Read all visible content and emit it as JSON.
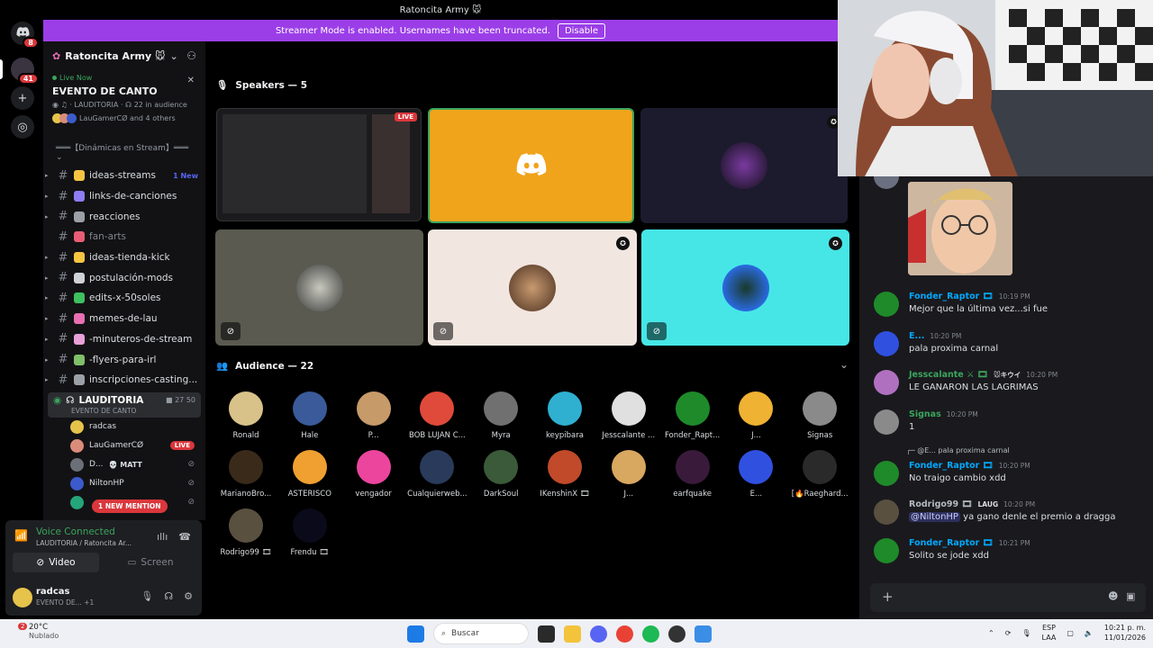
{
  "window": {
    "title": "Ratoncita Army 🐭"
  },
  "banner": {
    "text": "Streamer Mode is enabled. Usernames have been truncated.",
    "button": "Disable"
  },
  "rail": {
    "dm_badge": "8",
    "server_badge": "41"
  },
  "server": {
    "name": "Ratoncita Army 🐭"
  },
  "live_event": {
    "status": "Live Now",
    "title": "EVENTO DE CANTO",
    "channel": "LAUDITORIA",
    "audience": "22 in audience",
    "people": "LauGamerCØ and 4 others"
  },
  "category": "═══【Dinámicas en Stream】═══",
  "channels": [
    {
      "name": "ideas-streams",
      "badge": "1 New",
      "color": "#f5c542"
    },
    {
      "name": "links-de-canciones",
      "badge": "",
      "color": "#8e7cf5"
    },
    {
      "name": "reacciones",
      "badge": "",
      "color": "#9aa0a6"
    },
    {
      "name": "fan-arts",
      "badge": "",
      "color": "#e85d75"
    },
    {
      "name": "ideas-tienda-kick",
      "badge": "",
      "color": "#f5c542"
    },
    {
      "name": "postulación-mods",
      "badge": "",
      "color": "#cfd2d6"
    },
    {
      "name": "edits-x-50soles",
      "badge": "",
      "color": "#3fbf5f"
    },
    {
      "name": "memes-de-lau",
      "badge": "",
      "color": "#e86fb2"
    },
    {
      "name": "-minuteros-de-stream",
      "badge": "",
      "color": "#e8a0d8"
    },
    {
      "name": "-flyers-para-irl",
      "badge": "",
      "color": "#7fbf6a"
    },
    {
      "name": "inscripciones-casting...",
      "badge": "",
      "color": "#9aa0a6"
    }
  ],
  "voice_channel": {
    "name": "LAUDITORIA",
    "event": "EVENTO DE CANTO",
    "counts": "27  50",
    "users": [
      {
        "name": "radcas",
        "tag": "",
        "color": "#e6c34a"
      },
      {
        "name": "LauGamerCØ",
        "tag": "LIVE",
        "color": "#d98c7a"
      },
      {
        "name": "D...",
        "tag": "💀 MATT",
        "color": "#6b6f78"
      },
      {
        "name": "NiltonHP",
        "tag": "",
        "color": "#3b5bcc"
      },
      {
        "name": "",
        "tag": "",
        "color": "#25a57a"
      }
    ],
    "mention": "1 NEW MENTION"
  },
  "voice_panel": {
    "title": "Voice Connected",
    "subtitle": "LAUDITORIA / Ratoncita Ar...",
    "video": "Video",
    "screen": "Screen"
  },
  "user": {
    "name": "radcas",
    "status": "EVENTO DE...",
    "extra": "+1"
  },
  "speakers": {
    "header": "Speakers — 5",
    "live_label": "LIVE"
  },
  "audience": {
    "header": "Audience — 22",
    "members": [
      {
        "name": "Ronald",
        "color": "#d8c28a"
      },
      {
        "name": "Hale",
        "color": "#3a5a9a"
      },
      {
        "name": "P...",
        "color": "#c79a6a"
      },
      {
        "name": "BOB LUJAN C...",
        "color": "#e04a3a"
      },
      {
        "name": "Myra",
        "color": "#707070"
      },
      {
        "name": "keypibara",
        "color": "#2fb0d0"
      },
      {
        "name": "Jesscalante ...",
        "color": "#e0e0e0"
      },
      {
        "name": "Fonder_Rapt...",
        "color": "#1f8a2a"
      },
      {
        "name": "J...",
        "color": "#f0b232"
      },
      {
        "name": "Signas",
        "color": "#8a8a8a"
      },
      {
        "name": "MarianoBro...",
        "color": "#3a2a1a"
      },
      {
        "name": "ASTERISCO",
        "color": "#f0a030"
      },
      {
        "name": "vengador",
        "color": "#eb459e"
      },
      {
        "name": "Cualquierweb...",
        "color": "#2a3a5a"
      },
      {
        "name": "DarkSoul",
        "color": "#3a5a3a"
      },
      {
        "name": "IKenshinX 🎞",
        "color": "#c04a2a"
      },
      {
        "name": "J...",
        "color": "#d8a860"
      },
      {
        "name": "earfquake",
        "color": "#3a1a3a"
      },
      {
        "name": "E...",
        "color": "#3050e0"
      },
      {
        "name": "[🔥Raeghard...",
        "color": "#2a2a2a"
      },
      {
        "name": "Rodrigo99 🎞",
        "color": "#5a5040"
      },
      {
        "name": "Frendu 🎞",
        "color": "#0a0a1a"
      }
    ]
  },
  "chat": {
    "messages": [
      {
        "author": "Fonder_Raptor 🎞",
        "time": "10:19 PM",
        "text": "Mejor que la última vez...si fue",
        "color": "#1f8a2a",
        "name_color": "#00a8fc"
      },
      {
        "author": "E...",
        "time": "10:20 PM",
        "text": "pala proxima carnal",
        "color": "#3050e0",
        "name_color": "#00a8fc"
      },
      {
        "author": "Jesscalante ⚔ 🎞",
        "tag": "🐭キウイ",
        "time": "10:20 PM",
        "text": "LE GANARON LAS LAGRIMAS",
        "color": "#b070c0",
        "name_color": "#3ba55d"
      },
      {
        "author": "Signas",
        "time": "10:20 PM",
        "text": "1",
        "color": "#8a8a8a",
        "name_color": "#3ba55d"
      },
      {
        "author": "Fonder_Raptor 🎞",
        "time": "10:20 PM",
        "text": "No traigo cambio xdd",
        "color": "#1f8a2a",
        "name_color": "#00a8fc",
        "reply": "@E... pala proxima carnal"
      },
      {
        "author": "Rodrigo99 🎞",
        "tag": "LAUG",
        "time": "10:20 PM",
        "mention": "@NiltonHP",
        "text": " ya gano denle el premio a dragga",
        "color": "#5a5040",
        "name_color": "#b5bac1"
      },
      {
        "author": "Fonder_Raptor 🎞",
        "time": "10:21 PM",
        "text": "Solito se jode xdd",
        "color": "#1f8a2a",
        "name_color": "#00a8fc"
      }
    ]
  },
  "taskbar": {
    "temp": "20°C",
    "weather": "Nublado",
    "search": "Buscar",
    "lang": "ESP",
    "lang2": "LAA",
    "time": "10:21 p. m.",
    "date": "11/01/2026",
    "badge": "2"
  },
  "colors": {
    "accent": "#5865f2",
    "banner": "#9b3ee8",
    "live": "#da373c",
    "speaker_yellow": "#f0a41c",
    "speaker_cyan": "#46e6e6"
  }
}
